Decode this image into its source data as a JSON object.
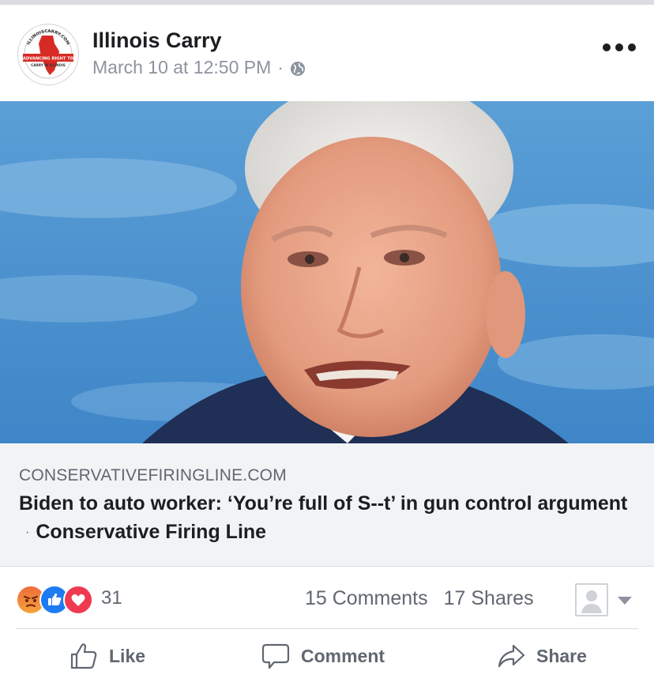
{
  "post": {
    "page_name": "Illinois Carry",
    "timestamp": "March 10 at 12:50 PM",
    "separator": "·",
    "privacy_icon": "globe-icon",
    "avatar_logo": {
      "top_arc": "ILLINOISCARRY.COM",
      "banner": "ADVANCING RIGHT TO",
      "bottom": "CARRY IN ILLINOIS"
    }
  },
  "link_preview": {
    "domain": "CONSERVATIVEFIRINGLINE.COM",
    "title": "Biden to auto worker: ‘You’re full of S--t’ in gun control argument",
    "dot": "·",
    "site_name": "Conservative Firing Line"
  },
  "engagement": {
    "reaction_icons": [
      "angry-icon",
      "like-icon",
      "love-icon"
    ],
    "reaction_count": "31",
    "comments": "15 Comments",
    "shares": "17 Shares"
  },
  "actions": {
    "like_label": "Like",
    "comment_label": "Comment",
    "share_label": "Share"
  },
  "colors": {
    "brand_blue": "#1d7cf2",
    "text_primary": "#1c1e21",
    "text_secondary": "#606770",
    "meta_gray": "#8d949e",
    "link_bg": "#f2f3f5"
  }
}
